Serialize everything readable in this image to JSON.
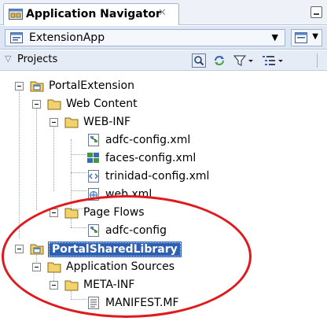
{
  "tab": {
    "title": "Application Navigator",
    "close_icon": "close-icon"
  },
  "app_selector": {
    "value": "ExtensionApp"
  },
  "projects": {
    "title": "Projects"
  },
  "tree": [
    {
      "label": "PortalExtension"
    },
    {
      "label": "Web Content"
    },
    {
      "label": "WEB-INF"
    },
    {
      "label": "adfc-config.xml"
    },
    {
      "label": "faces-config.xml"
    },
    {
      "label": "trinidad-config.xml"
    },
    {
      "label": "web.xml"
    },
    {
      "label": "Page Flows"
    },
    {
      "label": "adfc-config"
    },
    {
      "label": "PortalSharedLibrary"
    },
    {
      "label": "Application Sources"
    },
    {
      "label": "META-INF"
    },
    {
      "label": "MANIFEST.MF"
    }
  ],
  "colors": {
    "highlight_ellipse": "#e0191c",
    "selection": "#2f5fb3"
  }
}
